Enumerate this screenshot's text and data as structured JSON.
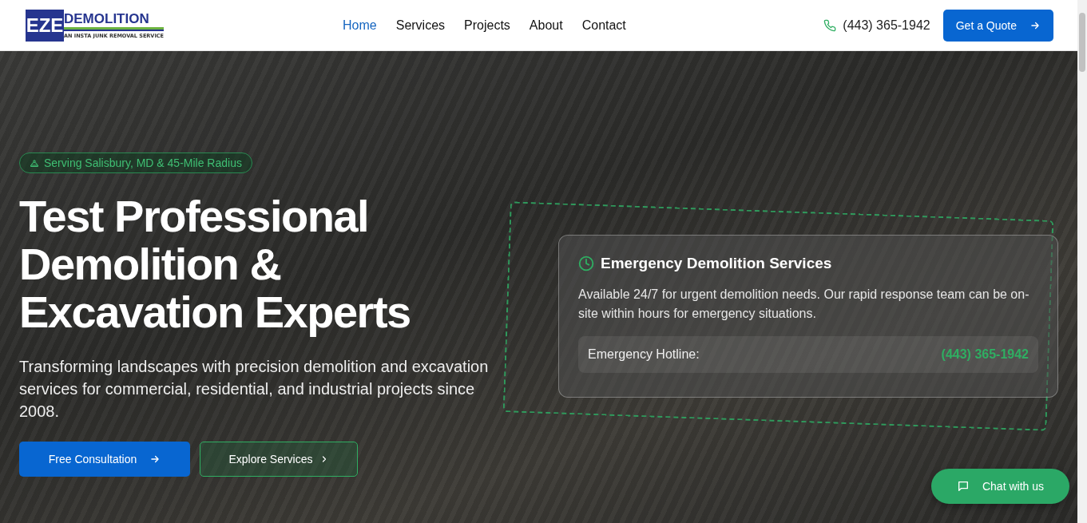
{
  "header": {
    "logo": {
      "mark": "EZE",
      "name": "DEMOLITION",
      "tagline": "AN INSTA JUNK REMOVAL SERVICE"
    },
    "nav": [
      {
        "label": "Home",
        "selected": true
      },
      {
        "label": "Services",
        "selected": false
      },
      {
        "label": "Projects",
        "selected": false
      },
      {
        "label": "About",
        "selected": false
      },
      {
        "label": "Contact",
        "selected": false
      }
    ],
    "phone": "(443) 365-1942",
    "cta": "Get a Quote"
  },
  "hero": {
    "badge": "Serving Salisbury, MD & 45-Mile Radius",
    "title": "Test Professional Demolition & Excavation Experts",
    "subtitle": "Transforming landscapes with precision demolition and excavation services for commercial, residential, and industrial projects since 2008.",
    "buttons": [
      {
        "label": "Free Consultation",
        "kind": "primary"
      },
      {
        "label": "Explore Services",
        "kind": "outline"
      }
    ]
  },
  "emergency_card": {
    "title": "Emergency Demolition Services",
    "text": "Available 24/7 for urgent demolition needs. Our rapid response team can be on-site within hours for emergency situations.",
    "hotline_label": "Emergency Hotline:",
    "hotline": "(443) 365-1942"
  },
  "chat_button": "Chat with us"
}
